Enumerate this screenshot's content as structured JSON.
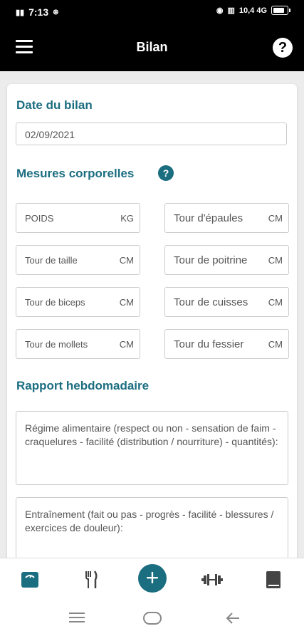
{
  "status_bar": {
    "time": "7:13",
    "right_text": "10,4 4G"
  },
  "app_bar": {
    "title": "Bilan",
    "help_label": "?"
  },
  "date_section": {
    "title": "Date du bilan",
    "value": "02/09/2021"
  },
  "mesures": {
    "title": "Mesures corporelles",
    "help_label": "?",
    "fields": [
      {
        "label": "POIDS",
        "unit": "KG"
      },
      {
        "label": "Tour d'épaules",
        "unit": "CM"
      },
      {
        "label": "Tour de taille",
        "unit": "CM"
      },
      {
        "label": "Tour de poitrine",
        "unit": "CM"
      },
      {
        "label": "Tour de biceps",
        "unit": "CM"
      },
      {
        "label": "Tour de cuisses",
        "unit": "CM"
      },
      {
        "label": "Tour de mollets",
        "unit": "CM"
      },
      {
        "label": "Tour du fessier",
        "unit": "CM"
      }
    ]
  },
  "rapport": {
    "title": "Rapport hebdomadaire",
    "regime_placeholder": "Régime alimentaire (respect ou non - sensation de faim - craquelures - facilité (distribution / nourriture) - quantités):",
    "entrainement_placeholder": "Entraînement (fait ou pas - progrès - facilité - blessures / exercices de douleur):"
  },
  "bottom_nav": {
    "add_label": "+"
  },
  "colors": {
    "accent": "#1b6d80",
    "appbar": "#000000"
  }
}
